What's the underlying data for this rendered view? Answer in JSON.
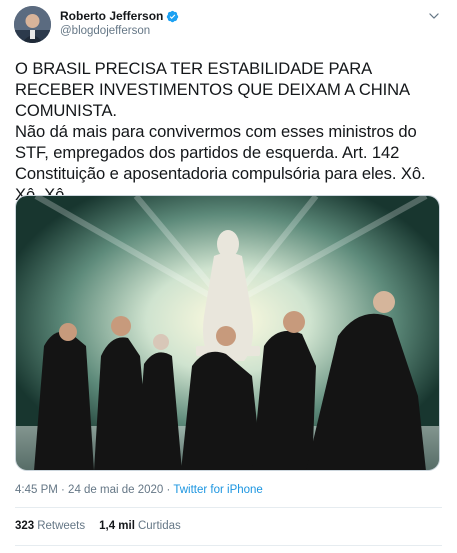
{
  "author": {
    "name": "Roberto Jefferson",
    "handle": "@blogdojefferson"
  },
  "tweet": {
    "text": "O BRASIL PRECISA TER ESTABILIDADE PARA RECEBER INVESTIMENTOS QUE DEIXAM A CHINA COMUNISTA.\nNão dá mais para convivermos com esses ministros do STF, empregados dos partidos de esquerda. Art. 142 Constituição e aposentadoria compulsória para eles. Xô. Xô. Xô."
  },
  "meta": {
    "timestamp": "4:45 PM · 24 de mai de 2020",
    "separator": " · ",
    "source": "Twitter for iPhone"
  },
  "stats": {
    "retweets_count": "323",
    "retweets_label": "Retweets",
    "likes_count": "1,4 mil",
    "likes_label": "Curtidas"
  },
  "colors": {
    "accent": "#1da1f2",
    "link": "#1b95e0",
    "secondary_text": "#657786"
  },
  "icons": {
    "verified": "verified-badge-icon",
    "caret": "chevron-down-icon"
  }
}
